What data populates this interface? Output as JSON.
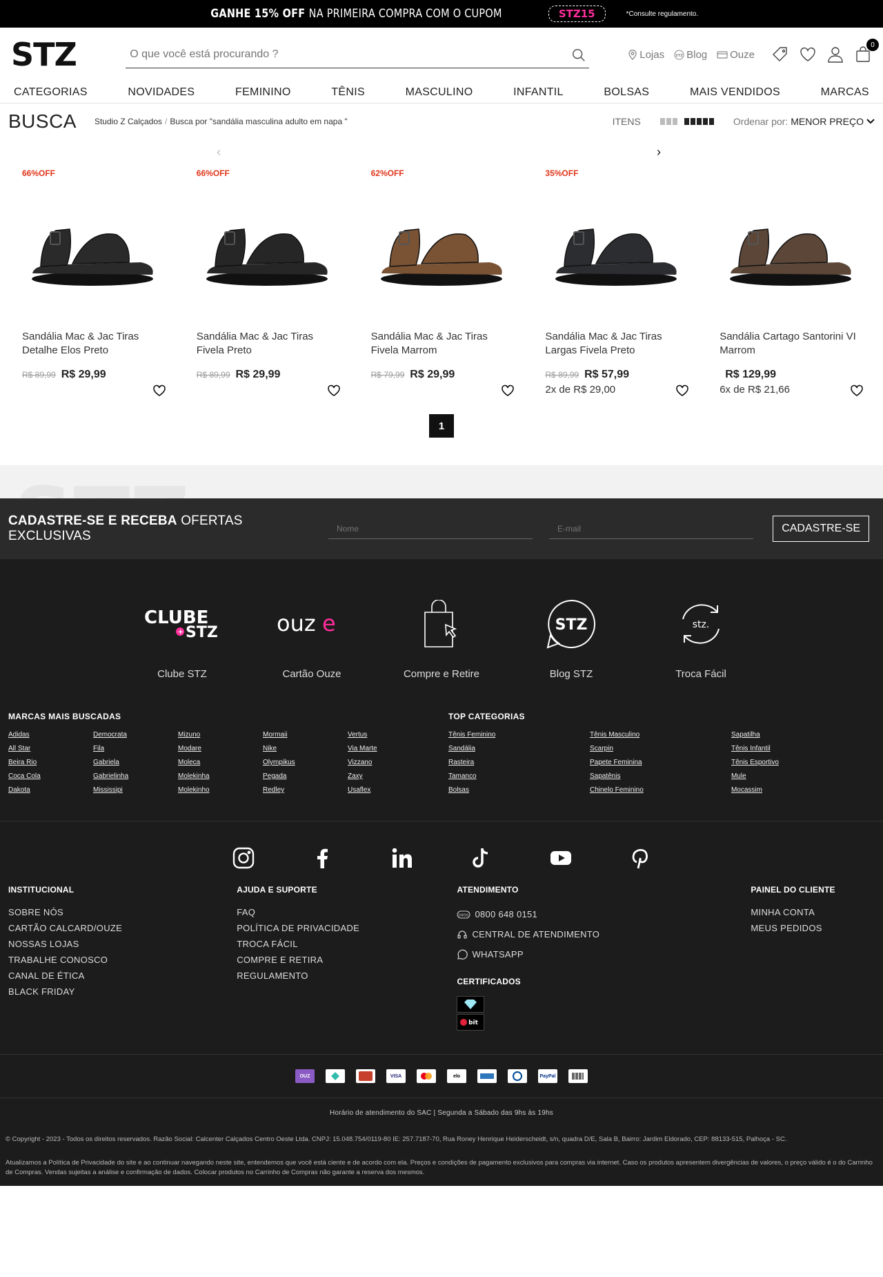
{
  "promo": {
    "bold": "GANHE 15% OFF",
    "rest": "NA PRIMEIRA COMPRA COM O CUPOM",
    "coupon": "STZ15",
    "note": "*Consulte regulamento."
  },
  "header": {
    "logo": "STZ",
    "search_placeholder": "O que você está procurando ?",
    "links": [
      "Lojas",
      "Blog",
      "Ouze"
    ],
    "cart_count": "0"
  },
  "nav": [
    "CATEGORIAS",
    "NOVIDADES",
    "FEMININO",
    "TÊNIS",
    "MASCULINO",
    "INFANTIL",
    "BOLSAS",
    "MAIS VENDIDOS",
    "MARCAS"
  ],
  "page": {
    "title": "BUSCA",
    "crumbs": [
      "Studio Z Calçados",
      "Busca por \"sandália masculina adulto em napa \""
    ],
    "items_label": "ITENS",
    "sort_label": "Ordenar por:",
    "sort_value": "MENOR PREÇO"
  },
  "products": [
    {
      "off": "66%OFF",
      "name": "Sandália Mac & Jac Tiras Detalhe Elos Preto",
      "old": "R$ 89,99",
      "price": "R$ 29,99",
      "inst": "",
      "color": "#2a2a2a"
    },
    {
      "off": "66%OFF",
      "name": "Sandália Mac & Jac Tiras Fivela Preto",
      "old": "R$ 89,99",
      "price": "R$ 29,99",
      "inst": "",
      "color": "#262626"
    },
    {
      "off": "62%OFF",
      "name": "Sandália Mac & Jac Tiras Fivela Marrom",
      "old": "R$ 79,99",
      "price": "R$ 29,99",
      "inst": "",
      "color": "#7a5234"
    },
    {
      "off": "35%OFF",
      "name": "Sandália Mac & Jac Tiras Largas Fivela Preto",
      "old": "R$ 89,99",
      "price": "R$ 57,99",
      "inst": "2x de R$ 29,00",
      "color": "#2c2d30"
    },
    {
      "off": "",
      "name": "Sandália Cartago Santorini VI Marrom",
      "old": "",
      "price": "R$ 129,99",
      "inst": "6x de R$ 21,66",
      "color": "#5b4638"
    }
  ],
  "pager": {
    "current": "1"
  },
  "newsletter": {
    "title_bold": "CADASTRE-SE E RECEBA",
    "title_rest": "OFERTAS EXCLUSIVAS",
    "name_ph": "Nome",
    "email_ph": "E-mail",
    "button": "CADASTRE-SE"
  },
  "features": [
    {
      "label": "Clube STZ",
      "logo": "CLUBE"
    },
    {
      "label": "Cartão Ouze",
      "logo": "ouze"
    },
    {
      "label": "Compre e Retire"
    },
    {
      "label": "Blog STZ",
      "logo": "STZ"
    },
    {
      "label": "Troca Fácil",
      "logo": "stz."
    }
  ],
  "brands": {
    "title": "MARCAS MAIS BUSCADAS",
    "cols": [
      [
        "Adidas",
        "All Star",
        "Beira Rio",
        "Coca Cola",
        "Dakota"
      ],
      [
        "Democrata",
        "Fila",
        "Gabriela",
        "Gabrielinha",
        "Mississipi"
      ],
      [
        "Mizuno",
        "Modare",
        "Moleca",
        "Molekinha",
        "Molekinho"
      ],
      [
        "Mormaii",
        "Nike",
        "Olympikus",
        "Pegada",
        "Redley"
      ],
      [
        "Vertus",
        "Via Marte",
        "Vizzano",
        "Zaxy",
        "Usaflex"
      ]
    ]
  },
  "categories": {
    "title": "TOP CATEGORIAS",
    "cols": [
      [
        "Tênis Feminino",
        "Sandália",
        "Rasteira",
        "Tamanco",
        "Bolsas"
      ],
      [
        "Tênis Masculino",
        "Scarpin",
        "Papete Feminina",
        "Sapatênis",
        "Chinelo Feminino"
      ],
      [
        "Sapatilha",
        "Tênis Infantil",
        "Tênis Esportivo",
        "Mule",
        "Mocassim"
      ]
    ]
  },
  "institucional": {
    "title": "INSTITUCIONAL",
    "items": [
      "SOBRE NÓS",
      "CARTÃO CALCARD/OUZE",
      "NOSSAS LOJAS",
      "TRABALHE CONOSCO",
      "CANAL DE ÉTICA",
      "BLACK FRIDAY"
    ]
  },
  "ajuda": {
    "title": "AJUDA E SUPORTE",
    "items": [
      "FAQ",
      "POLÍTICA DE PRIVACIDADE",
      "TROCA FÁCIL",
      "COMPRE E RETIRA",
      "REGULAMENTO"
    ]
  },
  "atendimento": {
    "title": "ATENDIMENTO",
    "items": [
      "0800 648 0151",
      "CENTRAL DE ATENDIMENTO",
      "WHATSAPP"
    ],
    "cert_title": "CERTIFICADOS"
  },
  "painel": {
    "title": "PAINEL DO CLIENTE",
    "items": [
      "MINHA CONTA",
      "MEUS PEDIDOS"
    ]
  },
  "payments": [
    "OUZ",
    "PIX",
    "CALCARD",
    "VISA",
    "MC",
    "elo",
    "AMEX",
    "DC",
    "PayPal",
    "BOL"
  ],
  "sac": "Horário de atendimento do SAC | Segunda a Sábado das 9hs às 19hs",
  "copyright": "© Copyright - 2023 - Todos os direitos reservados. Razão Social: Calcenter Calçados Centro Oeste Ltda. CNPJ: 15.048.754/0119-80 IE: 257.7187-70, Rua Roney Henrique Heiderscheidt, s/n, quadra D/E, Sala B, Bairro: Jardim Eldorado, CEP: 88133-515, Palhoça - SC.",
  "disclaimer": "Atualizamos a Política de Privacidade do site e ao continuar navegando neste site, entendemos que você está ciente e de acordo com ela. Preços e condições de pagamento exclusivos para compras via internet. Caso os produtos apresentem divergências de valores, o preço válido é o do Carrinho de Compras. Vendas sujeitas a análise e confirmação de dados. Colocar produtos no Carrinho de Compras não garante a reserva dos mesmos."
}
